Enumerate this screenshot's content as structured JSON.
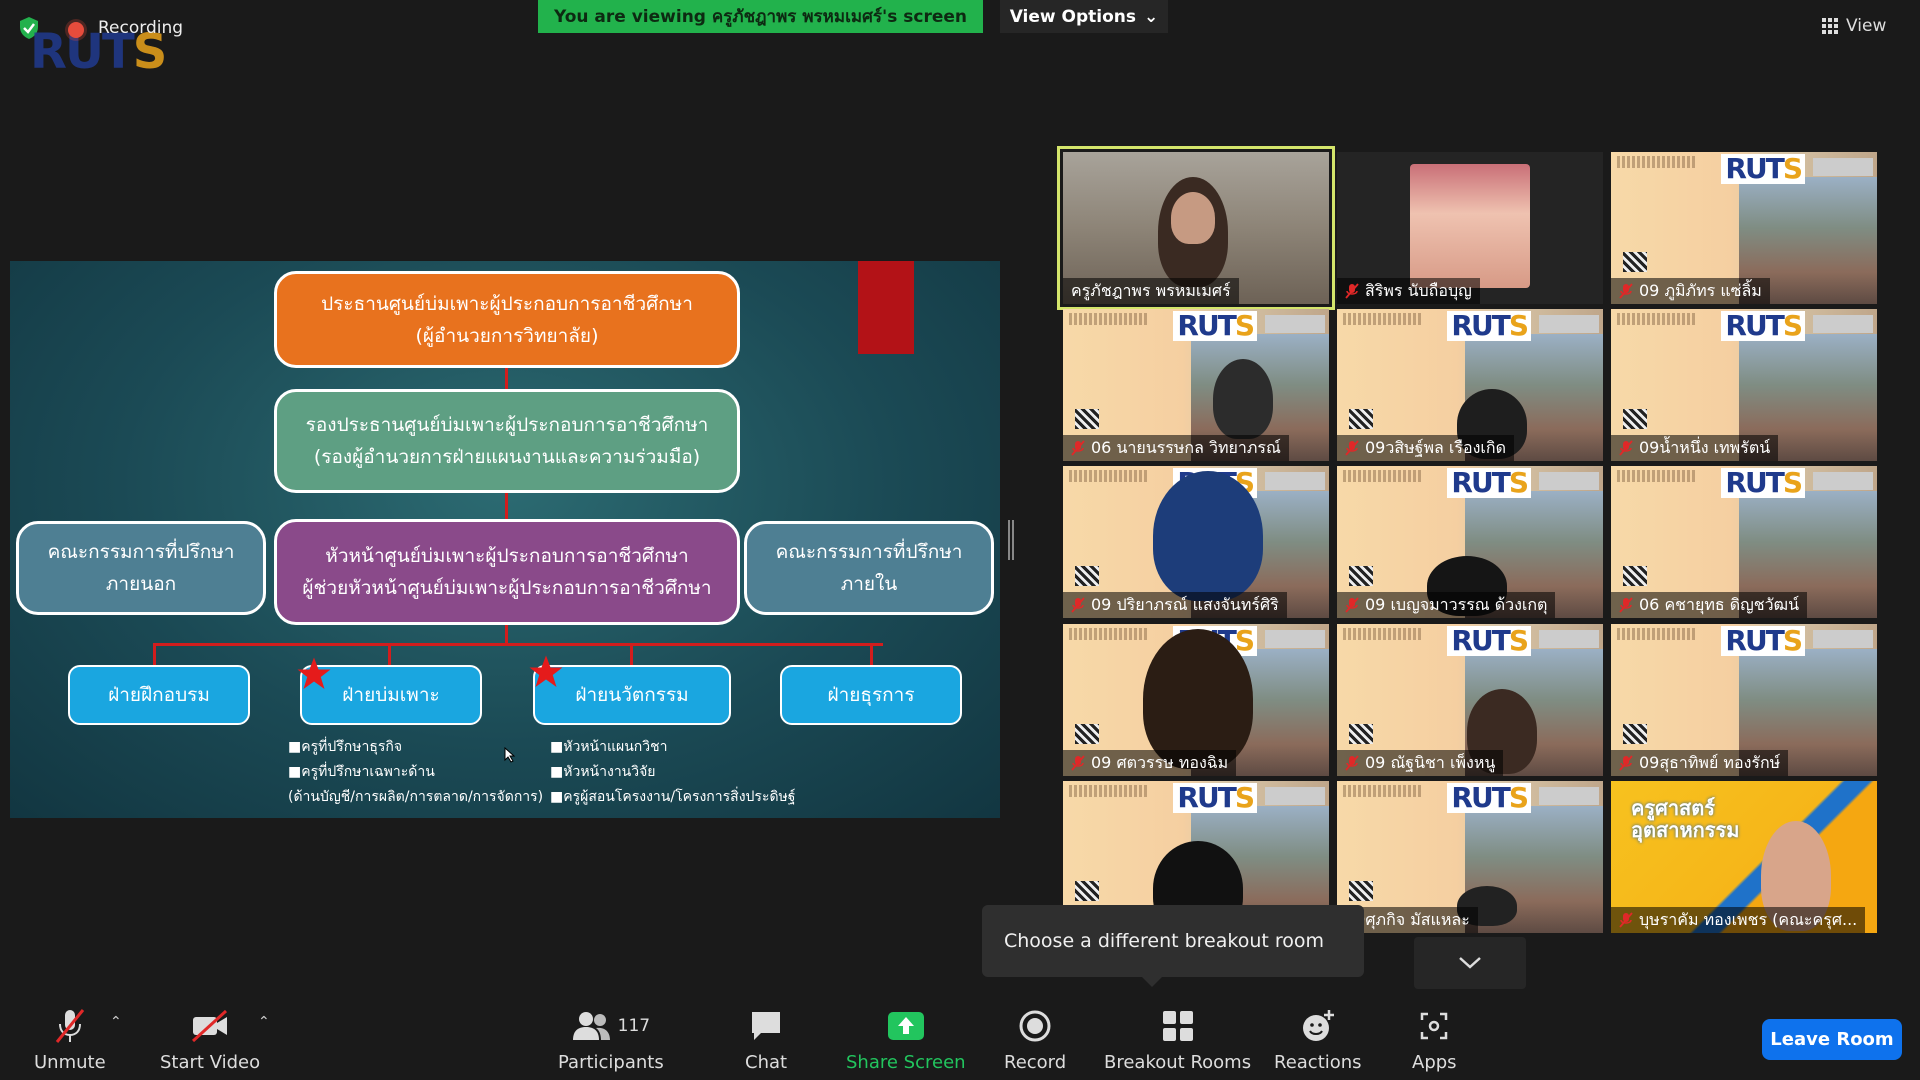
{
  "topbar": {
    "recording_label": "Recording",
    "viewing_banner": "You are viewing ครูภัชฎาพร  พรหมเมศร์'s screen",
    "view_options_label": "View Options",
    "view_label": "View",
    "logo_text": "RUTS"
  },
  "slide": {
    "top_box": [
      "ประธานศูนย์บ่มเพาะผู้ประกอบการอาชีวศึกษา",
      "(ผู้อำนวยการวิทยาลัย)"
    ],
    "second_box": [
      "รองประธานศูนย์บ่มเพาะผู้ประกอบการอาชีวศึกษา",
      "(รองผู้อำนวยการฝ่ายแผนงานและความร่วมมือ)"
    ],
    "middle_box": [
      "หัวหน้าศูนย์บ่มเพาะผู้ประกอบการอาชีวศึกษา",
      "ผู้ช่วยหัวหน้าศูนย์บ่มเพาะผู้ประกอบการอาชีวศึกษา"
    ],
    "left_box": [
      "คณะกรรมการที่ปรึกษา",
      "ภายนอก"
    ],
    "right_box": [
      "คณะกรรมการที่ปรึกษา",
      "ภายใน"
    ],
    "departments": [
      "ฝ่ายฝึกอบรม",
      "ฝ่ายบ่มเพาะ",
      "ฝ่ายนวัตกรรม",
      "ฝ่ายธุรการ"
    ],
    "notes_incubation": [
      "■ครูที่ปรึกษาธุรกิจ",
      "■ครูที่ปรึกษาเฉพาะด้าน",
      "(ด้านบัญชี/การผลิต/การตลาด/การจัดการ)"
    ],
    "notes_innovation": [
      "■หัวหน้าแผนกวิชา",
      "■หัวหน้างานวิจัย",
      "■ครูผู้สอนโครงงาน/โครงการสิ่งประดิษฐ์"
    ]
  },
  "participants": [
    {
      "name": "ครูภัชฎาพร  พรหมเมศร์",
      "muted": false
    },
    {
      "name": "สิริพร นับถือบุญ",
      "muted": true
    },
    {
      "name": "09 ภูมิภัทร แซ่ลิ้ม",
      "muted": true
    },
    {
      "name": "06 นายนรรษกล วิทยาภรณ์",
      "muted": true
    },
    {
      "name": "09วสิษฐ์พล เรืองเกิด",
      "muted": true
    },
    {
      "name": "09น้ำหนึ่ง เทพรัตน์",
      "muted": true
    },
    {
      "name": "09 ปริยาภรณ์ แสงจันทร์ศิริ",
      "muted": true
    },
    {
      "name": "09 เบญจมาวรรณ ด้วงเกตุ",
      "muted": true
    },
    {
      "name": "06 คชายุทธ ดิญชวัฒน์",
      "muted": true
    },
    {
      "name": "09 ศตวรรษ ทองฉิม",
      "muted": true
    },
    {
      "name": "09 ณัฐนิชา เพ็งหนู",
      "muted": true
    },
    {
      "name": "09สุธาทิพย์ ทองรักษ์",
      "muted": true
    },
    {
      "name": "",
      "muted": false
    },
    {
      "name": "09ศุภกิจ มัสแหละ",
      "muted": false
    },
    {
      "name": "บุษราคัม ทองเพชร (คณะครุศ...",
      "muted": true
    }
  ],
  "tooltip": "Choose a different breakout room",
  "toolbar": {
    "unmute": "Unmute",
    "start_video": "Start Video",
    "participants": "Participants",
    "participants_count": "117",
    "chat": "Chat",
    "share_screen": "Share Screen",
    "record": "Record",
    "breakout_rooms": "Breakout Rooms",
    "reactions": "Reactions",
    "apps": "Apps",
    "leave_room": "Leave Room"
  },
  "colors": {
    "share_green": "#22c55e",
    "leave_blue": "#0e72ed",
    "banner_green": "#22b24c",
    "active_speaker": "#d4e56b"
  },
  "promo_text": "ครูศาสตร์ อุตสาหกรรม"
}
